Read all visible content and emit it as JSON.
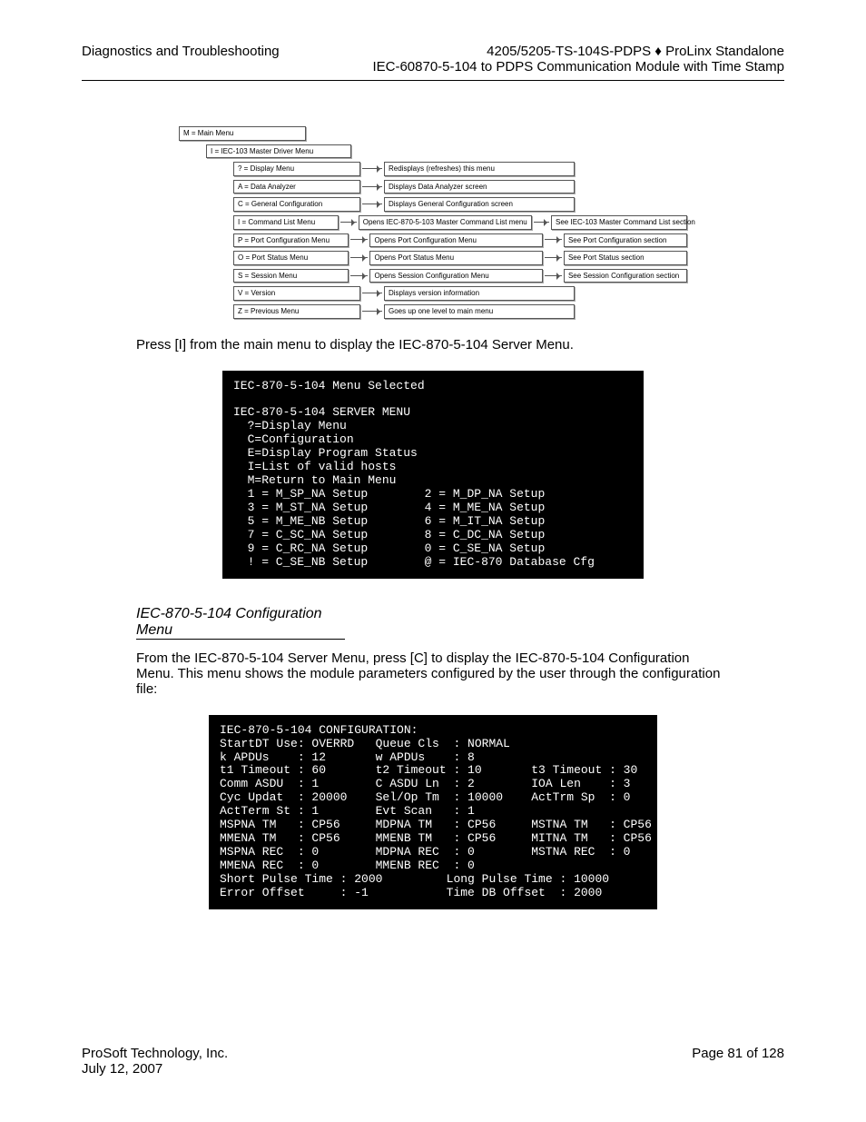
{
  "header": {
    "left": "Diagnostics and Troubleshooting",
    "right1": "4205/5205-TS-104S-PDPS ♦ ProLinx Standalone",
    "right2": "IEC-60870-5-104 to PDPS Communication Module with Time Stamp"
  },
  "diagram": {
    "root": "M = Main Menu",
    "level1": "I = IEC-103 Master Driver Menu",
    "rows": [
      {
        "a": "? = Display Menu",
        "b": "Redisplays (refreshes) this menu",
        "c": ""
      },
      {
        "a": "A = Data Analyzer",
        "b": "Displays Data Analyzer screen",
        "c": ""
      },
      {
        "a": "C = General Configuration",
        "b": "Displays General Configuration screen",
        "c": ""
      },
      {
        "a": "I = Command List Menu",
        "b": "Opens IEC-870-5-103 Master Command List menu",
        "c": "See IEC-103 Master Command List section"
      },
      {
        "a": "P = Port Configuration Menu",
        "b": "Opens Port Configuration Menu",
        "c": "See Port Configuration section"
      },
      {
        "a": "O = Port Status Menu",
        "b": "Opens Port Status Menu",
        "c": "See Port Status section"
      },
      {
        "a": "S = Session Menu",
        "b": "Opens Session Configuration Menu",
        "c": "See Session Configuration section"
      },
      {
        "a": "V = Version",
        "b": "Displays version information",
        "c": ""
      },
      {
        "a": "Z = Previous Menu",
        "b": "Goes up one level to main menu",
        "c": ""
      }
    ]
  },
  "body": {
    "p1": "Press [I] from the main menu to display the IEC-870-5-104 Server Menu."
  },
  "terminal1": {
    "title": "IEC-870-5-104 Menu Selected",
    "heading": "IEC-870-5-104 SERVER MENU",
    "l1": "  ?=Display Menu",
    "l2": "  C=Configuration",
    "l3": "  E=Display Program Status",
    "l4": "  I=List of valid hosts",
    "l5": "  M=Return to Main Menu",
    "r1a": "  1 = M_SP_NA Setup",
    "r1b": "2 = M_DP_NA Setup",
    "r2a": "  3 = M_ST_NA Setup",
    "r2b": "4 = M_ME_NA Setup",
    "r3a": "  5 = M_ME_NB Setup",
    "r3b": "6 = M_IT_NA Setup",
    "r4a": "  7 = C_SC_NA Setup",
    "r4b": "8 = C_DC_NA Setup",
    "r5a": "  9 = C_RC_NA Setup",
    "r5b": "0 = C_SE_NA Setup",
    "r6a": "  ! = C_SE_NB Setup",
    "r6b": "@ = IEC-870 Database Cfg"
  },
  "section_title": "IEC-870-5-104 Configuration Menu",
  "body2": {
    "p1": "From the IEC-870-5-104 Server Menu, press [C] to display the IEC-870-5-104 Configuration Menu. This menu shows the module parameters configured by the user through the configuration file:"
  },
  "chart_data": {
    "type": "table",
    "title": "IEC-870-5-104 CONFIGURATION:",
    "rows": [
      {
        "StartDT Use": "OVERRD",
        "Queue Cls": "NORMAL"
      },
      {
        "k APDUs": 12,
        "w APDUs": 8
      },
      {
        "t1 Timeout": 60,
        "t2 Timeout": 10,
        "t3 Timeout": 30
      },
      {
        "Comm ASDU": 1,
        "C ASDU Ln": 2,
        "IOA Len": 3
      },
      {
        "Cyc Updat": 20000,
        "Sel/Op Tm": 10000,
        "ActTrm Sp": 0
      },
      {
        "ActTerm St": 1,
        "Evt Scan": 1
      },
      {
        "MSPNA TM": "CP56",
        "MDPNA TM": "CP56",
        "MSTNA TM": "CP56"
      },
      {
        "MMENA TM": "CP56",
        "MMENB TM": "CP56",
        "MITNA TM": "CP56"
      },
      {
        "MSPNA REC": 0,
        "MDPNA REC": 0,
        "MSTNA REC": 0
      },
      {
        "MMENA REC": 0,
        "MMENB REC": 0
      },
      {
        "Short Pulse Time": 2000,
        "Long Pulse Time": 10000
      },
      {
        "Error Offset": -1,
        "Time DB Offset": 2000
      }
    ]
  },
  "terminal2": {
    "l0": "IEC-870-5-104 CONFIGURATION:",
    "l1": "StartDT Use: OVERRD   Queue Cls  : NORMAL",
    "l2": "k APDUs    : 12       w APDUs    : 8",
    "l3": "t1 Timeout : 60       t2 Timeout : 10       t3 Timeout : 30",
    "l4": "Comm ASDU  : 1        C ASDU Ln  : 2        IOA Len    : 3",
    "l5": "Cyc Updat  : 20000    Sel/Op Tm  : 10000    ActTrm Sp  : 0",
    "l6": "ActTerm St : 1        Evt Scan   : 1",
    "l7": "MSPNA TM   : CP56     MDPNA TM   : CP56     MSTNA TM   : CP56",
    "l8": "MMENA TM   : CP56     MMENB TM   : CP56     MITNA TM   : CP56",
    "l9": "MSPNA REC  : 0        MDPNA REC  : 0        MSTNA REC  : 0",
    "l10": "MMENA REC  : 0        MMENB REC  : 0",
    "l11": "Short Pulse Time : 2000         Long Pulse Time : 10000",
    "l12": "Error Offset     : -1           Time DB Offset  : 2000"
  },
  "footer": {
    "company": "ProSoft Technology, Inc.",
    "date": "July 12, 2007",
    "page": "Page 81 of 128"
  }
}
